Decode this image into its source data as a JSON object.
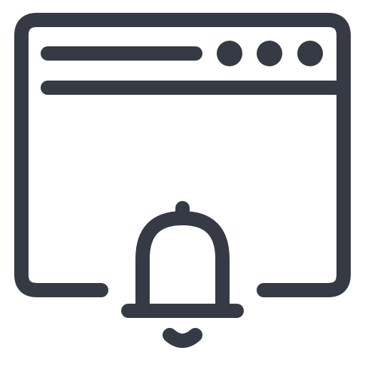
{
  "icon": {
    "name": "browser-window-notification-bell-icon",
    "stroke_color": "#353a44",
    "background_color": "#ffffff",
    "parts": {
      "window": "browser-window-icon",
      "address_bar": "address-bar-line",
      "window_controls": [
        "window-dot-1",
        "window-dot-2",
        "window-dot-3"
      ],
      "toolbar_divider": "toolbar-divider-line",
      "bell": "bell-icon"
    }
  }
}
